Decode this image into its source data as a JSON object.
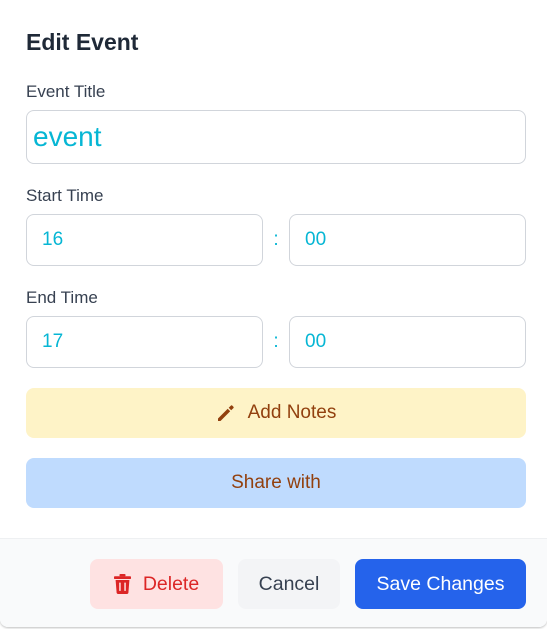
{
  "dialog": {
    "title": "Edit Event"
  },
  "form": {
    "event_title_label": "Event Title",
    "event_title_value": "event",
    "start_time_label": "Start Time",
    "start_hour": "16",
    "start_minute": "00",
    "end_time_label": "End Time",
    "end_hour": "17",
    "end_minute": "00",
    "time_separator": ":"
  },
  "actions": {
    "add_notes_label": "Add Notes",
    "add_notes_icon": "pencil-icon",
    "share_label": "Share with"
  },
  "footer": {
    "delete_label": "Delete",
    "delete_icon": "trash-icon",
    "cancel_label": "Cancel",
    "save_label": "Save Changes"
  },
  "colors": {
    "input_text": "#06b6d4",
    "notes_bg": "#fef3c7",
    "notes_text": "#92400e",
    "share_bg": "#bfdbfe",
    "delete_bg": "#fee2e2",
    "delete_text": "#dc2626",
    "save_bg": "#2563eb"
  }
}
